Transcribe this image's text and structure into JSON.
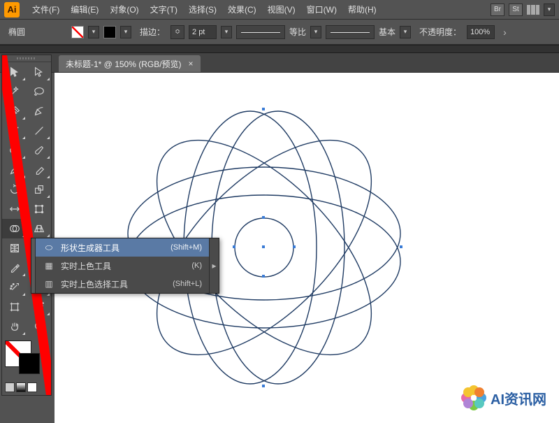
{
  "menubar": {
    "items": [
      "文件(F)",
      "编辑(E)",
      "对象(O)",
      "文字(T)",
      "选择(S)",
      "效果(C)",
      "视图(V)",
      "窗口(W)",
      "帮助(H)"
    ],
    "right_badges": [
      "Br",
      "St"
    ]
  },
  "controlbar": {
    "shape_label": "椭圆",
    "stroke_label": "描边：",
    "stroke_weight": "2 pt",
    "profile_label": "等比",
    "brush_label": "基本",
    "opacity_label": "不透明度：",
    "opacity_value": "100%"
  },
  "tab": {
    "title": "未标题-1* @ 150% (RGB/预览)",
    "close": "×"
  },
  "flyout": {
    "items": [
      {
        "icon": "⬭",
        "label": "形状生成器工具",
        "shortcut": "(Shift+M)",
        "selected": true
      },
      {
        "icon": "▦",
        "label": "实时上色工具",
        "shortcut": "(K)",
        "selected": false
      },
      {
        "icon": "▥",
        "label": "实时上色选择工具",
        "shortcut": "(Shift+L)",
        "selected": false
      }
    ]
  },
  "watermark": {
    "text": "AI资讯网"
  }
}
